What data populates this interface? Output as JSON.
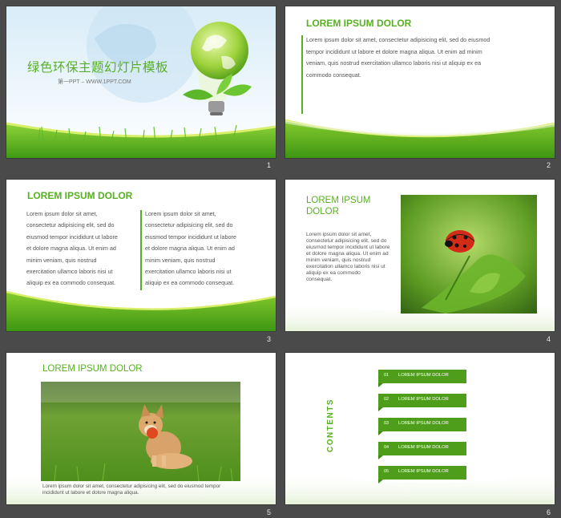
{
  "slides": [
    {
      "number": "1",
      "title": "绿色环保主题幻灯片模板",
      "subtitle": "第一PPT – WWW.1PPT.COM"
    },
    {
      "number": "2",
      "title": "LOREM IPSUM DOLOR",
      "paragraph": [
        "Lorem ipsum dolor sit amet, consectetur adipisicing elit, sed do eiusmod",
        "tempor incididunt ut labore et dolore magna aliqua. Ut enim ad minim",
        "veniam, quis nostrud exercitation ullamco laboris nisi ut aliquip ex ea",
        "commodo consequat."
      ]
    },
    {
      "number": "3",
      "title": "LOREM IPSUM DOLOR",
      "col1": [
        "Lorem ipsum dolor sit amet,",
        "consectetur adipisicing elit, sed do",
        "eiusmod tempor incididunt ut labore",
        "et dolore magna aliqua. Ut enim ad",
        "minim veniam, quis nostrud",
        "exercitation ullamco laboris nisi ut",
        "aliquip ex ea commodo consequat."
      ],
      "col2": [
        "Lorem ipsum dolor sit amet,",
        "consectetur adipisicing elit, sed do",
        "eiusmod tempor incididunt ut labore",
        "et dolore magna aliqua. Ut enim ad",
        "minim veniam, quis nostrud",
        "exercitation ullamco laboris nisi ut",
        "aliquip ex ea commodo consequat."
      ]
    },
    {
      "number": "4",
      "title_line1": "LOREM IPSUM",
      "title_line2": "DOLOR",
      "paragraph": [
        "Lorem ipsum dolor sit amet,",
        "consectetur adipisicing elit, sed do",
        "eiusmod tempor incididunt ut labore",
        "et dolore magna aliqua. Ut enim ad",
        "minim veniam, quis nostrud",
        "exercitation ullamco laboris nisi ut",
        "aliquip ex ea commodo",
        "consequat."
      ]
    },
    {
      "number": "5",
      "title": "LOREM IPSUM DOLOR",
      "caption_line1": "Lorem ipsum dolor sit amet, consectetur adipisicing elit, sed do eiusmod tempor",
      "caption_line2": "incididunt ut labore et dolore magna aliqua."
    },
    {
      "number": "6",
      "contents_label": "CONTENTS",
      "items": [
        {
          "num": "01",
          "label": "LOREM IPSUM DOLOR"
        },
        {
          "num": "02",
          "label": "LOREM IPSUM DOLOR"
        },
        {
          "num": "03",
          "label": "LOREM IPSUM DOLOR"
        },
        {
          "num": "04",
          "label": "LOREM IPSUM DOLOR"
        },
        {
          "num": "05",
          "label": "LOREM IPSUM DOLOR"
        }
      ]
    }
  ],
  "colors": {
    "accent": "#57b021",
    "background": "#4a4a4a",
    "ribbon": "#4e9e1b"
  }
}
